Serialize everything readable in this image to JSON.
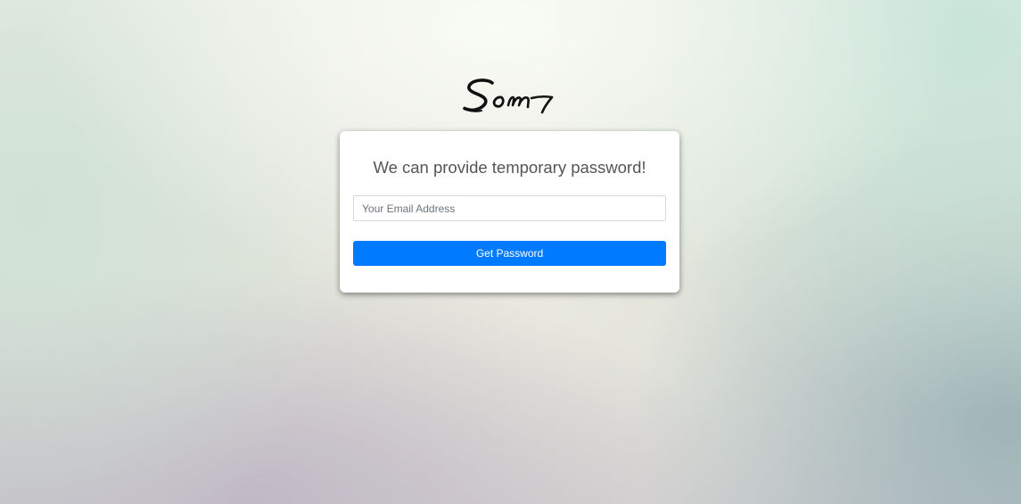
{
  "logo": {
    "text": "Som",
    "color": "#111111"
  },
  "card": {
    "title": "We can provide temporary password!",
    "email_placeholder": "Your Email Address",
    "email_value": "",
    "submit_label": "Get Password"
  },
  "colors": {
    "primary": "#007bff",
    "title_text": "#555555",
    "card_background": "#ffffff"
  }
}
